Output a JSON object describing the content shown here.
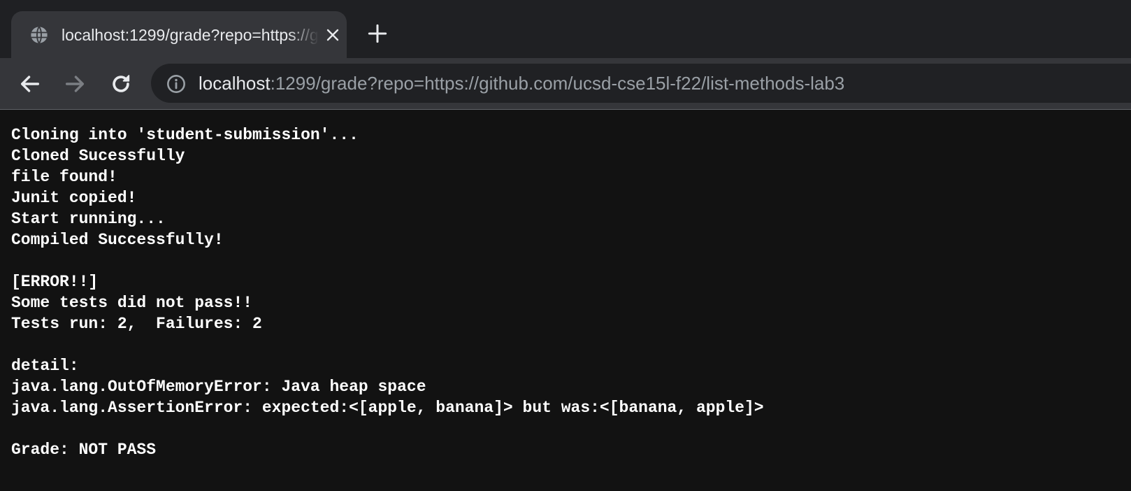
{
  "tab": {
    "title": "localhost:1299/grade?repo=https://github.com/ucsd-cse15l-f22/list-methods-lab3",
    "favicon": "globe-icon",
    "close": "close-icon"
  },
  "new_tab": "plus-icon",
  "toolbar": {
    "back": "arrow-left-icon",
    "forward": "arrow-right-icon",
    "reload": "reload-icon"
  },
  "address_bar": {
    "info_icon": "info-icon",
    "host": "localhost",
    "rest": ":1299/grade?repo=https://github.com/ucsd-cse15l-f22/list-methods-lab3"
  },
  "output": {
    "lines": [
      "Cloning into 'student-submission'...",
      "Cloned Sucessfully",
      "file found!",
      "Junit copied!",
      "Start running...",
      "Compiled Successfully!",
      "",
      "[ERROR!!]",
      "Some tests did not pass!!",
      "Tests run: 2,  Failures: 2",
      "",
      "detail:",
      "java.lang.OutOfMemoryError: Java heap space",
      "java.lang.AssertionError: expected:<[apple, banana]> but was:<[banana, apple]>",
      "",
      "Grade: NOT PASS"
    ]
  },
  "colors": {
    "tabstrip": "#1f2023",
    "toolbar": "#35363a",
    "omnibox": "#202124",
    "page_bg": "#121212",
    "text": "#ffffff"
  }
}
